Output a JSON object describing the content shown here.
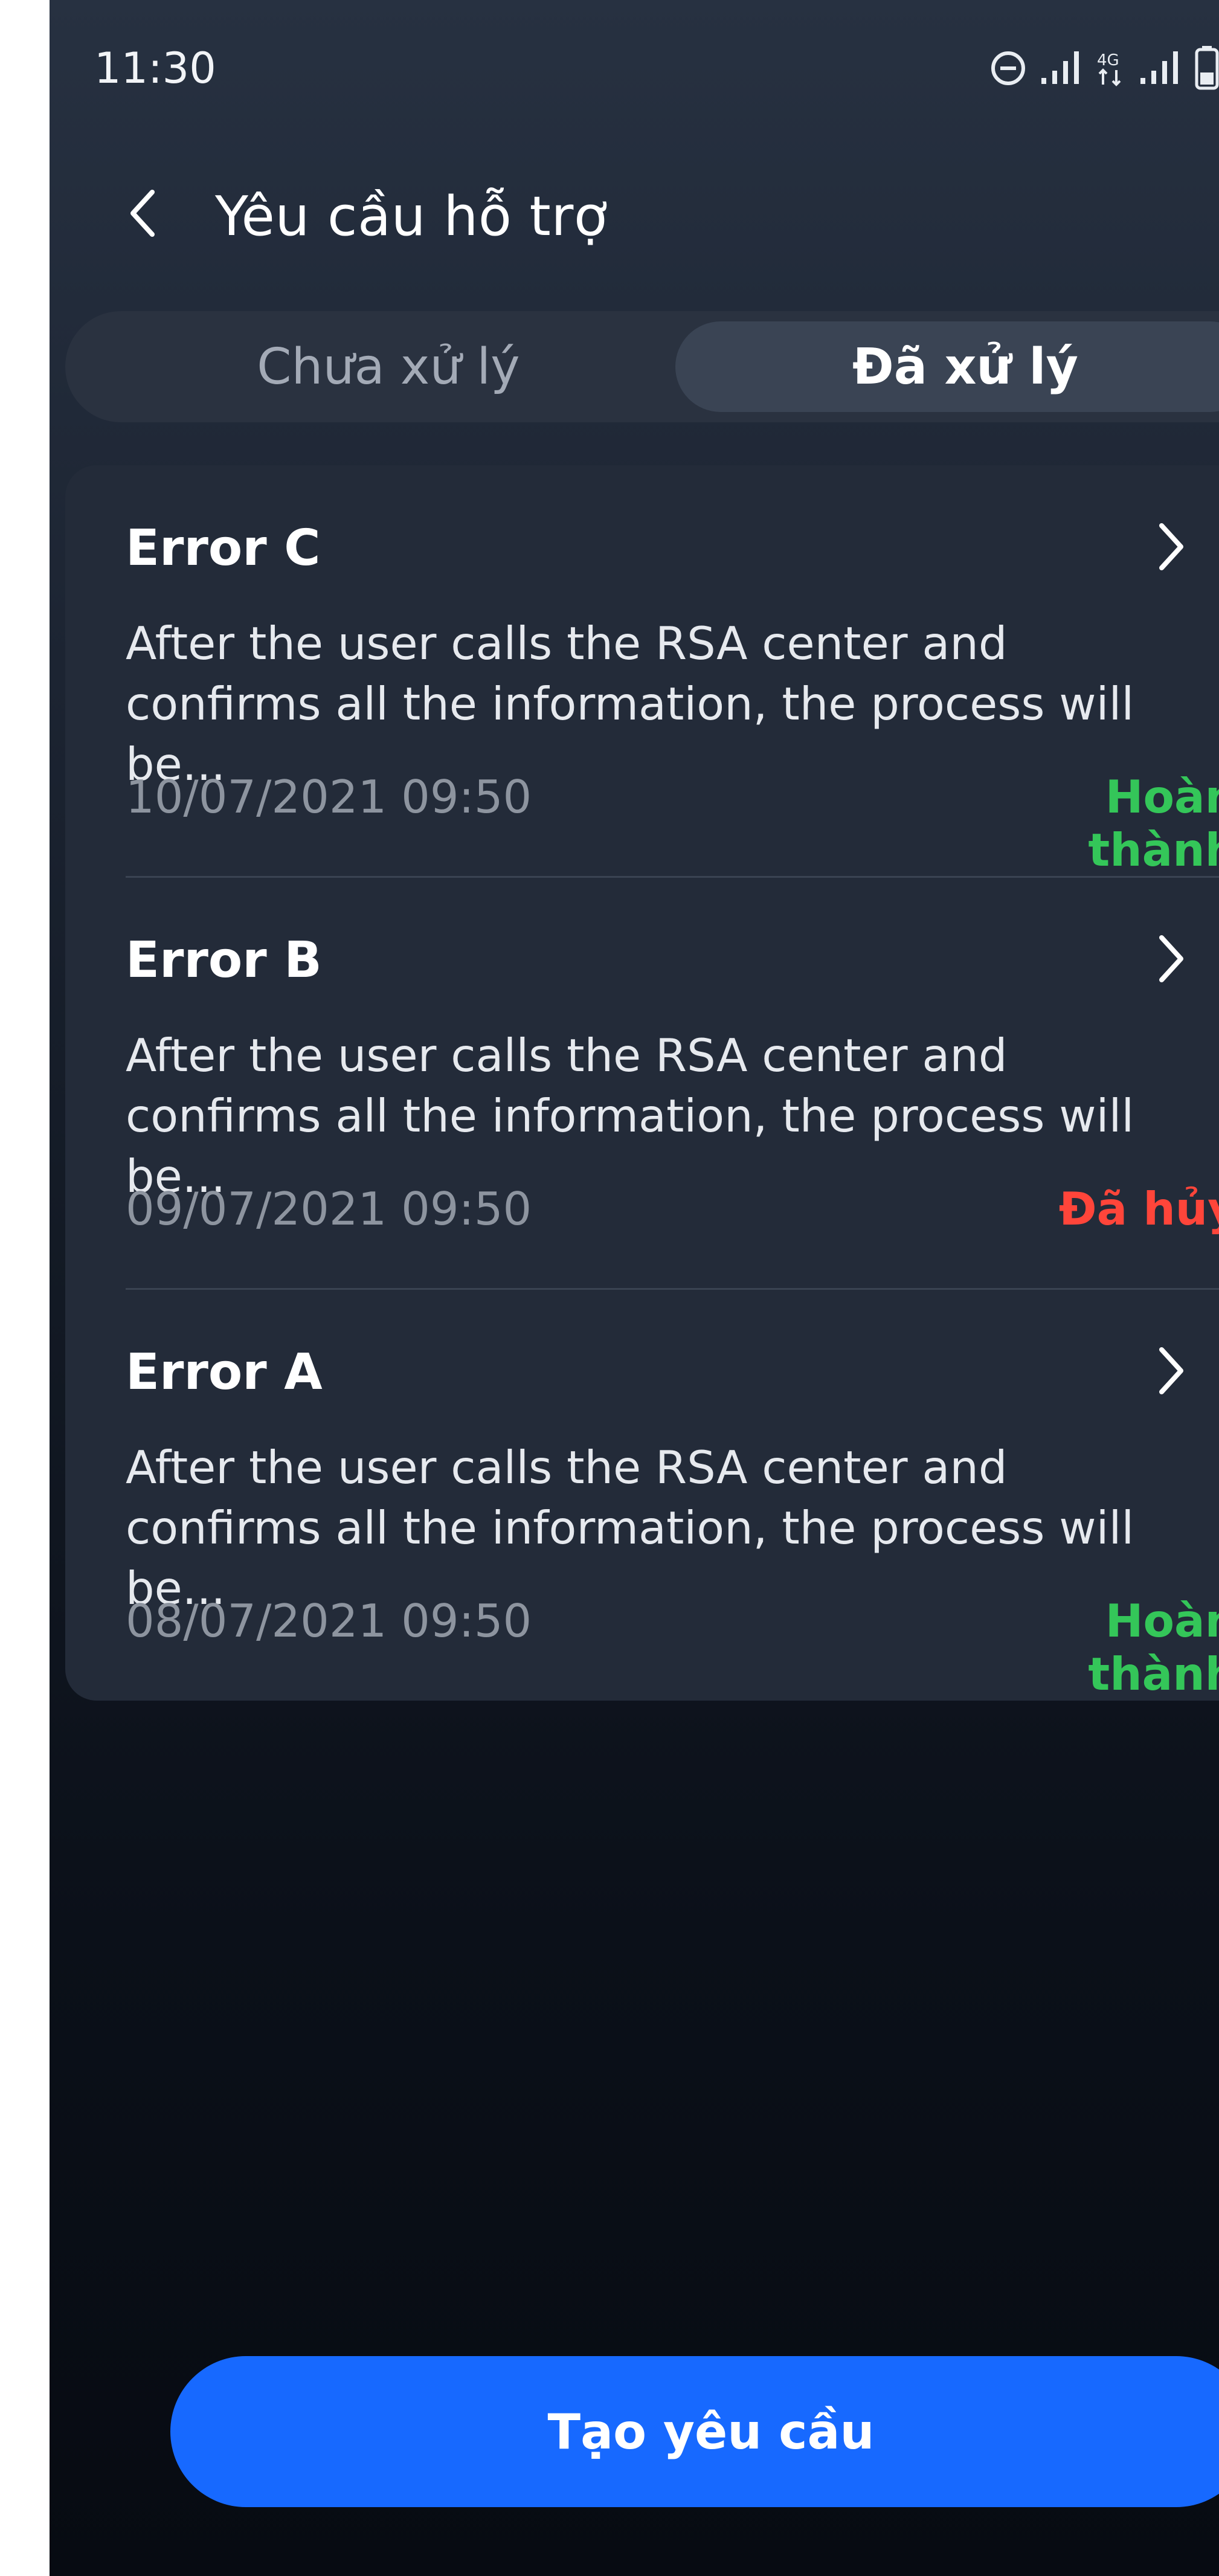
{
  "statusbar": {
    "time": "11:30",
    "icons": [
      "dnd-icon",
      "signal-icon",
      "4g-icon",
      "signal-icon",
      "battery-icon"
    ],
    "network_label": "4G"
  },
  "header": {
    "back_icon": "chevron-left-icon",
    "title": "Yêu cầu hỗ trợ"
  },
  "tabs": [
    {
      "label": "Chưa xử lý",
      "selected": false
    },
    {
      "label": "Đã xử lý",
      "selected": true
    }
  ],
  "requests": [
    {
      "title": "Error C",
      "description": "After the user calls the RSA center and confirms all the information, the process will be...",
      "datetime": "10/07/2021 09:50",
      "status": "Hoàn thành",
      "status_color": "#34c659"
    },
    {
      "title": "Error B",
      "description": "After the user calls the RSA center and confirms all the information, the process will be...",
      "datetime": "09/07/2021 09:50",
      "status": "Đã hủy",
      "status_color": "#ff453a"
    },
    {
      "title": "Error A",
      "description": "After the user calls the RSA center and confirms all the information, the process will be...",
      "datetime": "08/07/2021 09:50",
      "status": "Hoàn thành",
      "status_color": "#34c659"
    }
  ],
  "cta": {
    "label": "Tạo yêu cầu"
  },
  "colors": {
    "accent": "#1769ff",
    "success": "#34c659",
    "danger": "#ff453a"
  }
}
